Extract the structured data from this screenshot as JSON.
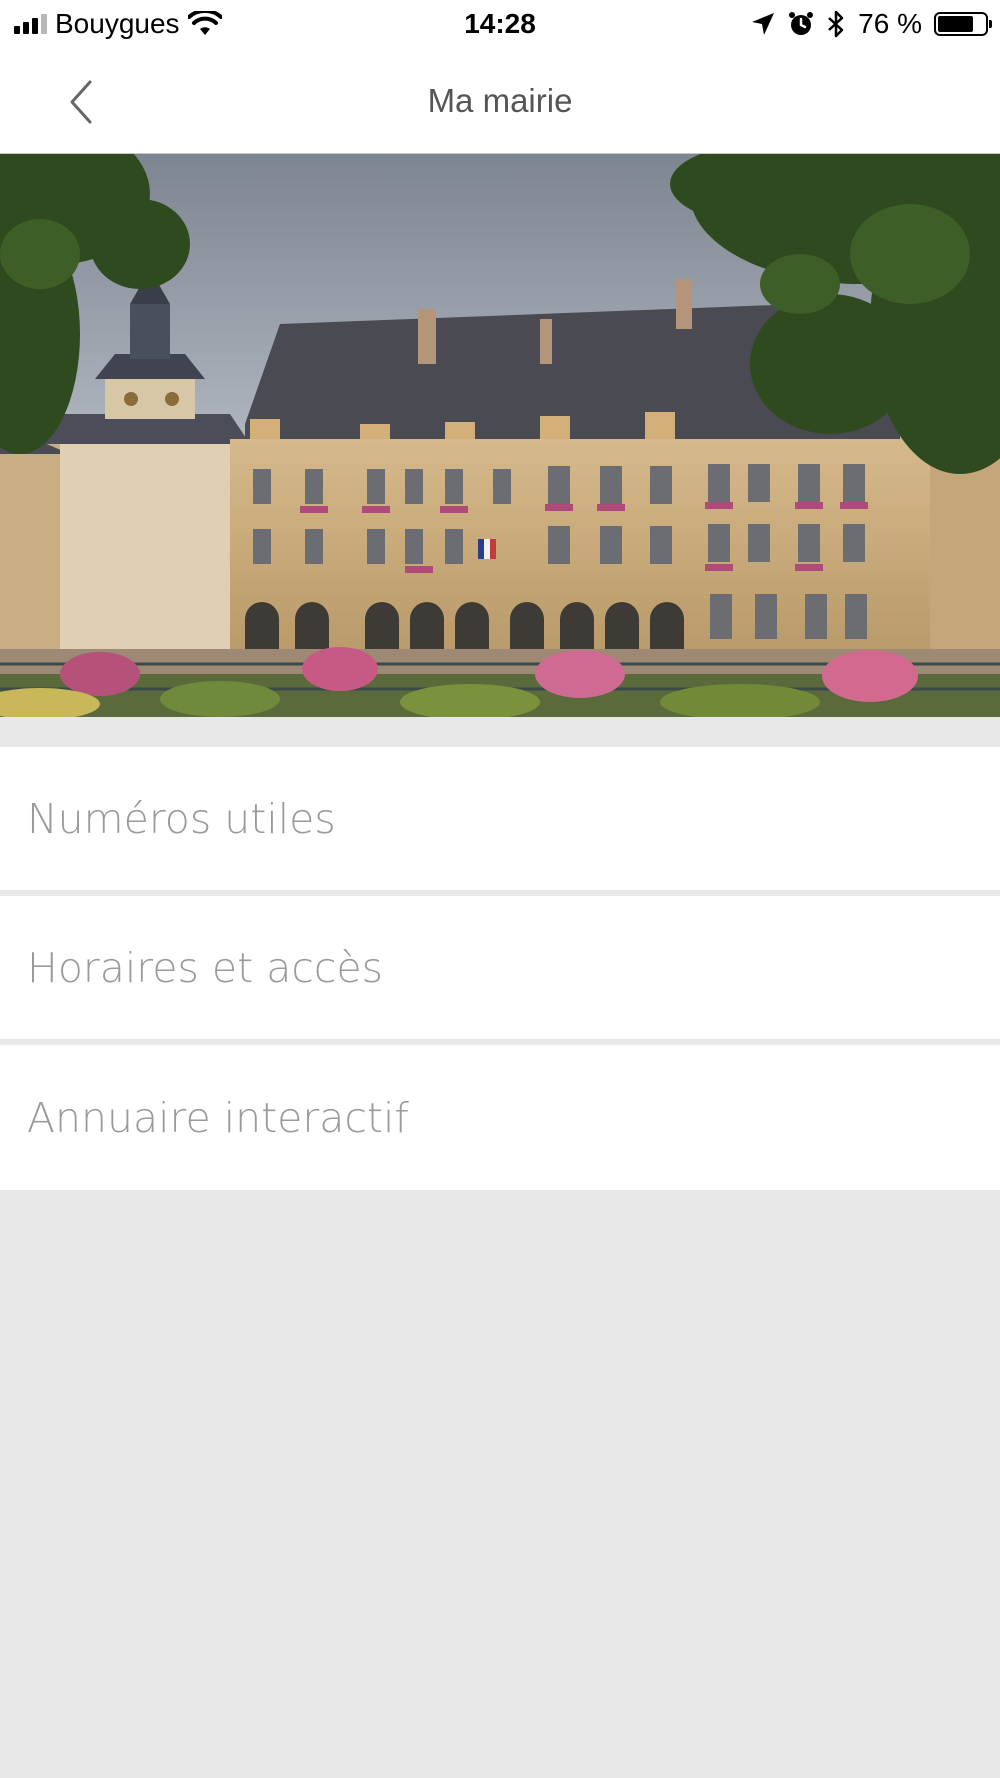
{
  "status_bar": {
    "carrier": "Bouygues",
    "time": "14:28",
    "battery_percent": "76 %",
    "battery_level": 0.76,
    "icons": [
      "signal-icon",
      "wifi-icon",
      "location-icon",
      "alarm-icon",
      "bluetooth-icon",
      "battery-icon"
    ]
  },
  "nav": {
    "title": "Ma mairie",
    "back_icon": "chevron-left-icon"
  },
  "hero": {
    "image_name": "town-hall-photo"
  },
  "menu": {
    "items": [
      {
        "label": "Numéros utiles"
      },
      {
        "label": "Horaires et accès"
      },
      {
        "label": "Annuaire interactif"
      }
    ]
  },
  "colors": {
    "background": "#e8e8e8",
    "surface": "#ffffff",
    "menu_text": "#9a9a9a",
    "title_text": "#555555"
  }
}
